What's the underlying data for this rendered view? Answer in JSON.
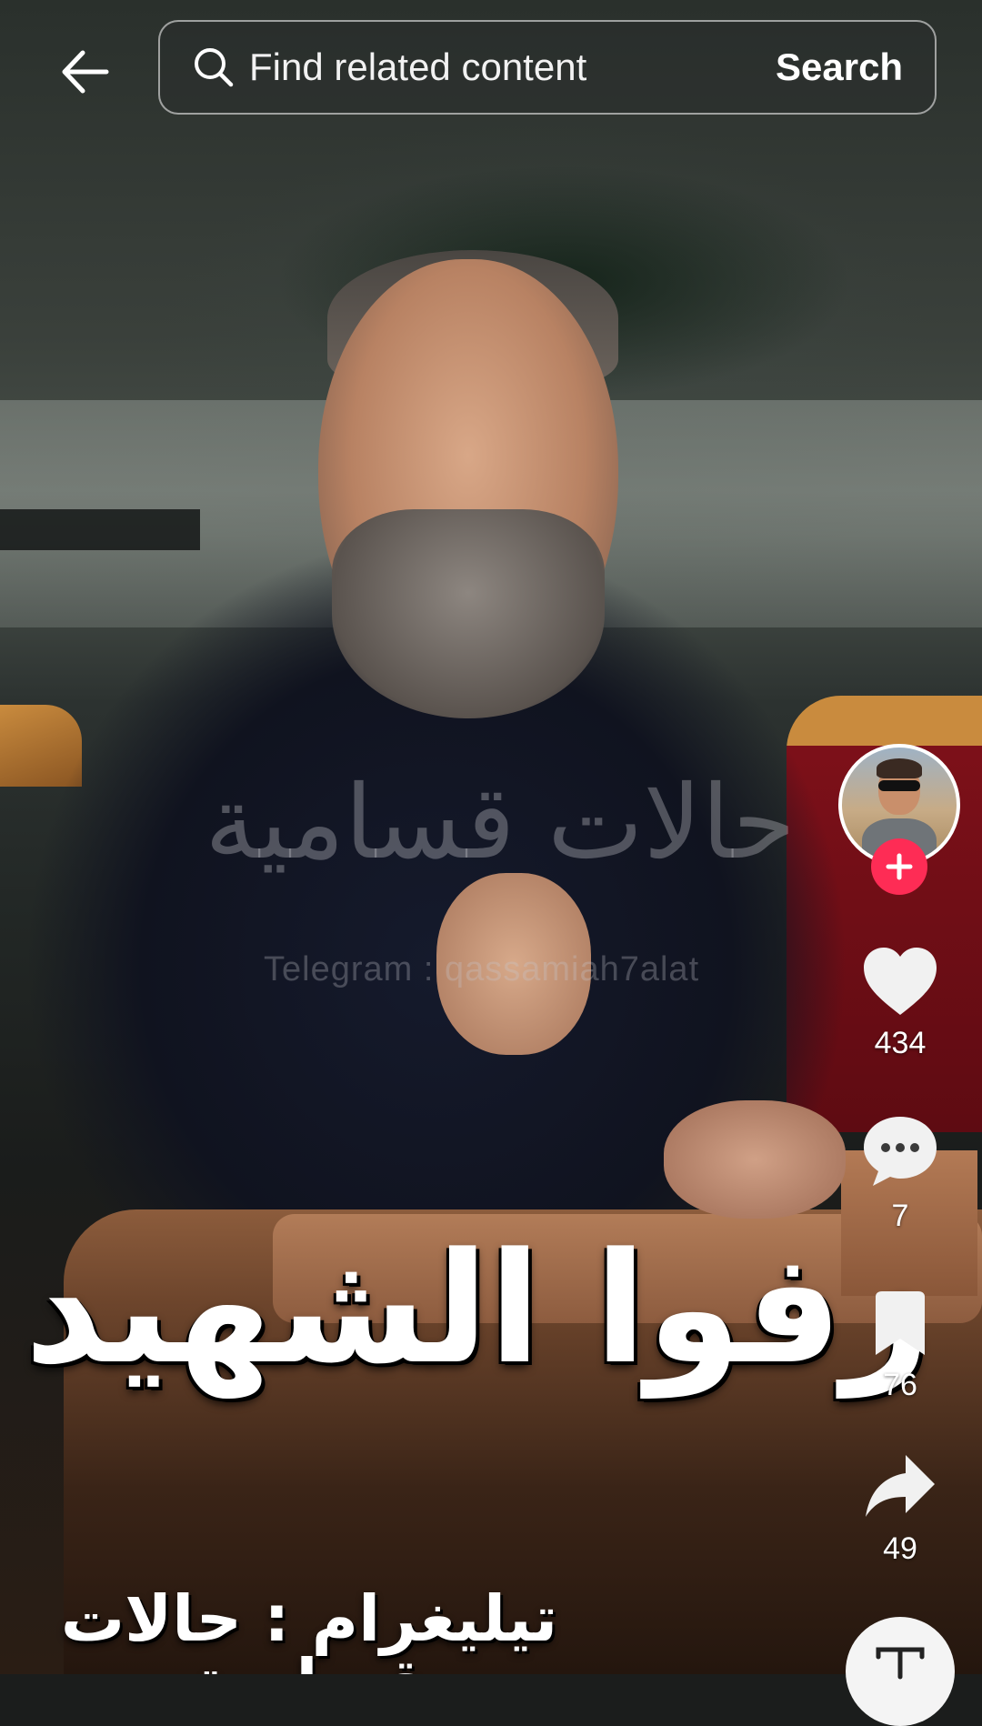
{
  "top_bar": {
    "back_icon": "arrow-left-icon",
    "search": {
      "placeholder": "Find related content",
      "value": "",
      "button_label": "Search"
    }
  },
  "video": {
    "watermark_arabic": "حالات قسامية",
    "watermark_telegram": "Telegram : qassamiah7alat",
    "caption_main": "زفوا الشهيد",
    "caption_footer": "تيليغرام : حالات قسامية"
  },
  "right_rail": {
    "follow_icon": "plus-icon",
    "likes": {
      "icon": "heart-icon",
      "count": "434"
    },
    "comments": {
      "icon": "comment-bubble-icon",
      "count": "7"
    },
    "saves": {
      "icon": "bookmark-icon",
      "count": "76"
    },
    "shares": {
      "icon": "share-arrow-icon",
      "count": "49"
    }
  },
  "colors": {
    "follow_accent": "#fe2c55",
    "icon_white": "#ffffff"
  }
}
